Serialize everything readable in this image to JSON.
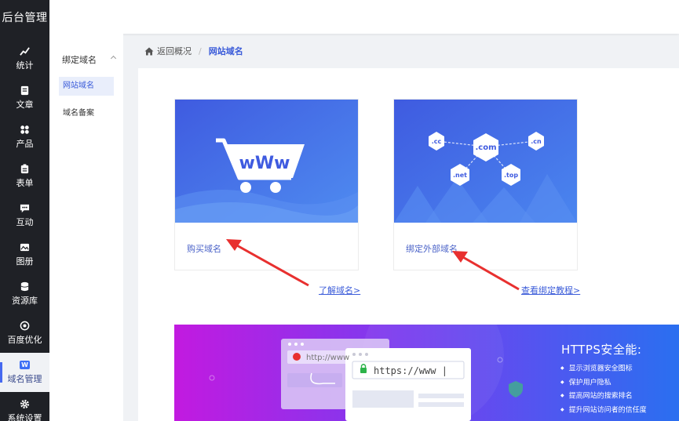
{
  "app": {
    "brand": "后台管理"
  },
  "nav": {
    "items": [
      {
        "label": "统计",
        "icon": "chart-icon"
      },
      {
        "label": "文章",
        "icon": "article-icon"
      },
      {
        "label": "产品",
        "icon": "grid-icon"
      },
      {
        "label": "表单",
        "icon": "form-icon"
      },
      {
        "label": "互动",
        "icon": "chat-icon"
      },
      {
        "label": "图册",
        "icon": "album-icon"
      },
      {
        "label": "资源库",
        "icon": "database-icon"
      },
      {
        "label": "百度优化",
        "icon": "seo-icon"
      },
      {
        "label": "域名管理",
        "icon": "domain-icon",
        "badge": "W",
        "active": true
      },
      {
        "label": "系统设置",
        "icon": "settings-icon"
      }
    ]
  },
  "subnav": {
    "group": "绑定域名",
    "items": [
      {
        "label": "网站域名",
        "active": true
      },
      {
        "label": "域名备案"
      }
    ]
  },
  "breadcrumb": {
    "back": "返回概况",
    "current": "网站域名"
  },
  "cards": [
    {
      "label": "购买域名",
      "link": "了解域名>"
    },
    {
      "label": "绑定外部域名",
      "link": "查看绑定教程>"
    }
  ],
  "domains": [
    ".cc",
    ".com",
    ".cn",
    ".net",
    ".top"
  ],
  "https": {
    "title": "HTTPS安全能:",
    "bullets": [
      "显示浏览器安全图标",
      "保护用户隐私",
      "提高网站的搜索排名",
      "提升网站访问者的信任度"
    ],
    "old_url": "http://www",
    "new_url": "https://www |"
  },
  "colors": {
    "accent": "#3a5bd9",
    "nav_bg": "#1f2126",
    "arrow": "#e8302f"
  }
}
